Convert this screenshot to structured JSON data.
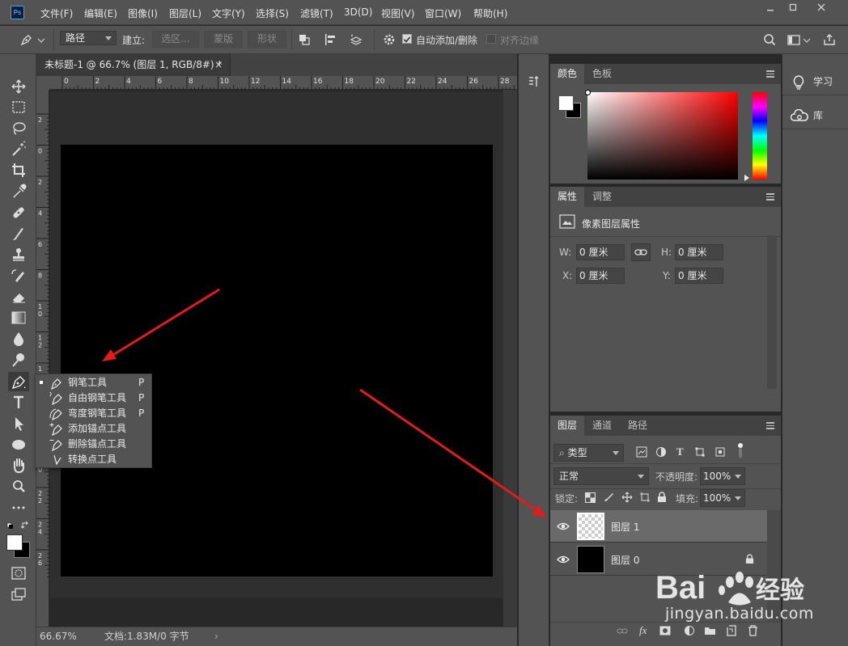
{
  "app": {
    "logo": "Ps",
    "menu": [
      "文件(F)",
      "编辑(E)",
      "图像(I)",
      "图层(L)",
      "文字(Y)",
      "选择(S)",
      "滤镜(T)",
      "3D(D)",
      "视图(V)",
      "窗口(W)",
      "帮助(H)"
    ],
    "window_controls": [
      "minimize-icon",
      "maximize-icon",
      "close-icon"
    ]
  },
  "options_bar": {
    "mode_value": "路径",
    "make_label": "建立:",
    "selection_btn": "选区...",
    "mask_btn": "蒙版",
    "shape_btn": "形状",
    "auto_add_delete": "自动添加/删除",
    "auto_add_delete_checked": true,
    "align_edges": "对齐边缘",
    "align_edges_checked": false
  },
  "document": {
    "tab_title": "未标题-1 @ 66.7% (图层 1, RGB/8#) *",
    "ruler_top": [
      "0",
      "2",
      "4",
      "6",
      "8",
      "10",
      "12",
      "14",
      "16",
      "18",
      "20",
      "22",
      "24",
      "26",
      "28"
    ],
    "ruler_left": [
      "2",
      "0",
      "2",
      "4",
      "6",
      "8",
      "1\n0",
      "1\n2",
      "1\n4",
      "1\n6",
      "1\n8",
      "2\n0",
      "2\n2",
      "2\n4",
      "2\n6"
    ],
    "zoom": "66.67%",
    "doc_info": "文档:1.83M/0 字节",
    "canvas_color": "#000000"
  },
  "pen_flyout": {
    "items": [
      {
        "label": "钢笔工具",
        "key": "P",
        "selected": true,
        "icon": "pen-icon"
      },
      {
        "label": "自由钢笔工具",
        "key": "P",
        "selected": false,
        "icon": "freeform-pen-icon"
      },
      {
        "label": "弯度钢笔工具",
        "key": "P",
        "selected": false,
        "icon": "curvature-pen-icon"
      },
      {
        "label": "添加锚点工具",
        "key": "",
        "selected": false,
        "icon": "add-anchor-icon"
      },
      {
        "label": "删除锚点工具",
        "key": "",
        "selected": false,
        "icon": "delete-anchor-icon"
      },
      {
        "label": "转换点工具",
        "key": "",
        "selected": false,
        "icon": "convert-point-icon"
      }
    ]
  },
  "color_panel": {
    "tabs": [
      "颜色",
      "色板"
    ],
    "foreground": "#ffffff",
    "background": "#000000",
    "hue_color": "#ff0000"
  },
  "properties_panel": {
    "tabs": [
      "属性",
      "调整"
    ],
    "title": "像素图层属性",
    "w_label": "W:",
    "w_value": "0 厘米",
    "h_label": "H:",
    "h_value": "0 厘米",
    "x_label": "X:",
    "x_value": "0 厘米",
    "y_label": "Y:",
    "y_value": "0 厘米"
  },
  "layers_panel": {
    "tabs": [
      "图层",
      "通道",
      "路径"
    ],
    "filter_kind": "类型",
    "blend_mode": "正常",
    "opacity_label": "不透明度:",
    "opacity_value": "100%",
    "lock_label": "锁定:",
    "fill_label": "填充:",
    "fill_value": "100%",
    "layers": [
      {
        "name": "图层 1",
        "visible": true,
        "selected": true,
        "locked": false,
        "thumb": "transparent"
      },
      {
        "name": "图层 0",
        "visible": true,
        "selected": false,
        "locked": true,
        "thumb": "black"
      }
    ],
    "footer_icons": [
      "link-icon",
      "fx-icon",
      "mask-icon",
      "adjustment-icon",
      "group-icon",
      "new-layer-icon",
      "trash-icon"
    ]
  },
  "side_panel": {
    "learn": "学习",
    "libraries": "库"
  },
  "watermark": {
    "brand": "Bai 经验",
    "url": "jingyan.baidu.com"
  },
  "annotation_color": "#e21b1b"
}
